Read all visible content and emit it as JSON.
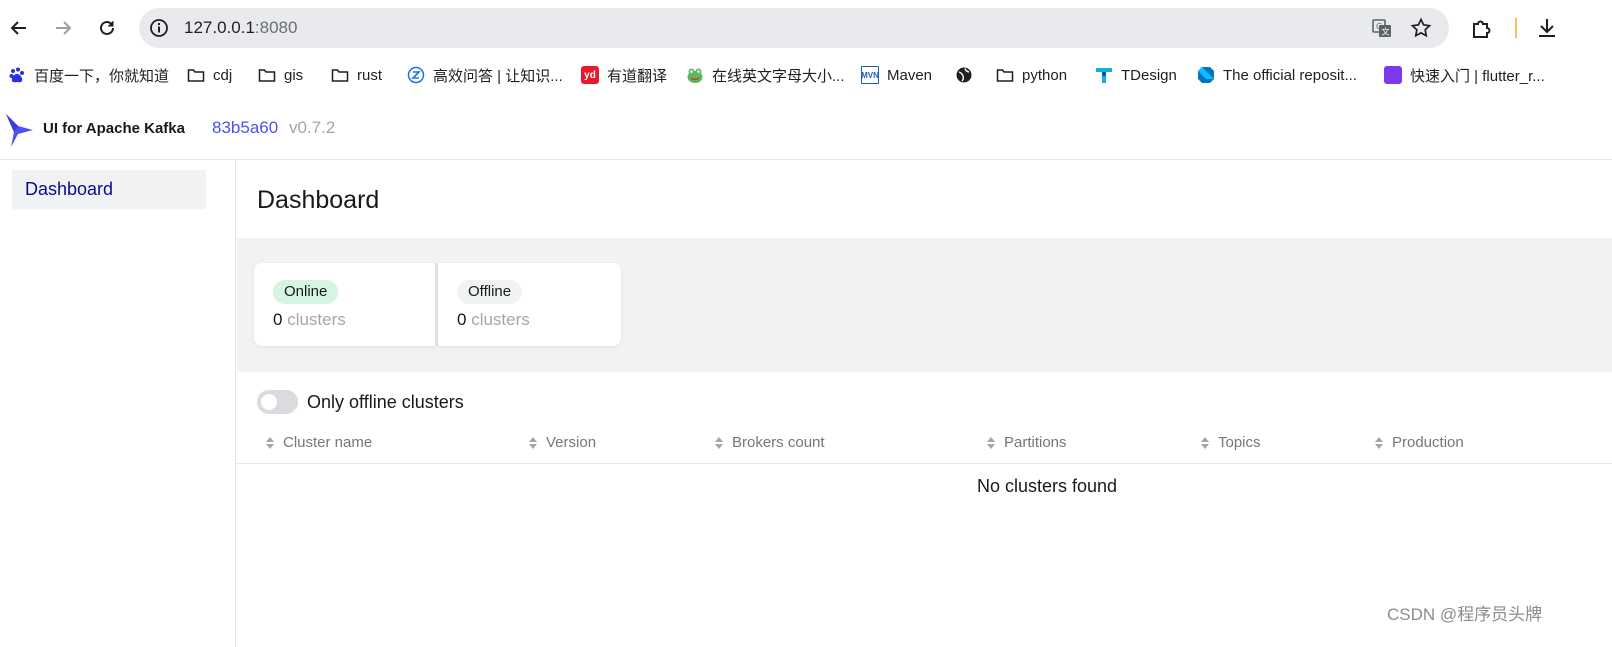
{
  "browser": {
    "url_host": "127.0.0.1",
    "url_port": ":8080",
    "bookmarks": [
      {
        "label": "百度一下，你就知道",
        "icon": "baidu-icon"
      },
      {
        "label": "cdj",
        "icon": "folder-icon"
      },
      {
        "label": "gis",
        "icon": "folder-icon"
      },
      {
        "label": "rust",
        "icon": "folder-icon"
      },
      {
        "label": "高效问答 | 让知识...",
        "icon": "zhihu-icon"
      },
      {
        "label": "有道翻译",
        "icon": "youdao-icon",
        "badge": "yd"
      },
      {
        "label": "在线英文字母大小...",
        "icon": "frog-icon"
      },
      {
        "label": "Maven",
        "icon": "maven-icon",
        "badge": "MVN"
      },
      {
        "label": "",
        "icon": "globe-icon"
      },
      {
        "label": "python",
        "icon": "folder-icon"
      },
      {
        "label": "TDesign",
        "icon": "tdesign-icon"
      },
      {
        "label": "The official reposit...",
        "icon": "dart-icon"
      },
      {
        "label": "快速入门 | flutter_r...",
        "icon": "purple-square-icon"
      }
    ]
  },
  "app": {
    "brand": "UI for Apache Kafka",
    "git_hash": "83b5a60",
    "version": "v0.7.2"
  },
  "sidebar": {
    "items": [
      {
        "label": "Dashboard"
      }
    ]
  },
  "main": {
    "title": "Dashboard",
    "stats": {
      "online": {
        "badge": "Online",
        "value": "0",
        "unit": "clusters"
      },
      "offline": {
        "badge": "Offline",
        "value": "0",
        "unit": "clusters"
      }
    },
    "toggle_label": "Only offline clusters",
    "toggle_on": false,
    "columns": [
      "Cluster name",
      "Version",
      "Brokers count",
      "Partitions",
      "Topics",
      "Production"
    ],
    "empty_message": "No clusters found"
  },
  "watermark": "CSDN @程序员头牌",
  "colors": {
    "accent": "#4f4ff5",
    "nav_active": "#0c0c87",
    "online_badge": "#d6f5e0",
    "band_bg": "#f1f2f3"
  }
}
